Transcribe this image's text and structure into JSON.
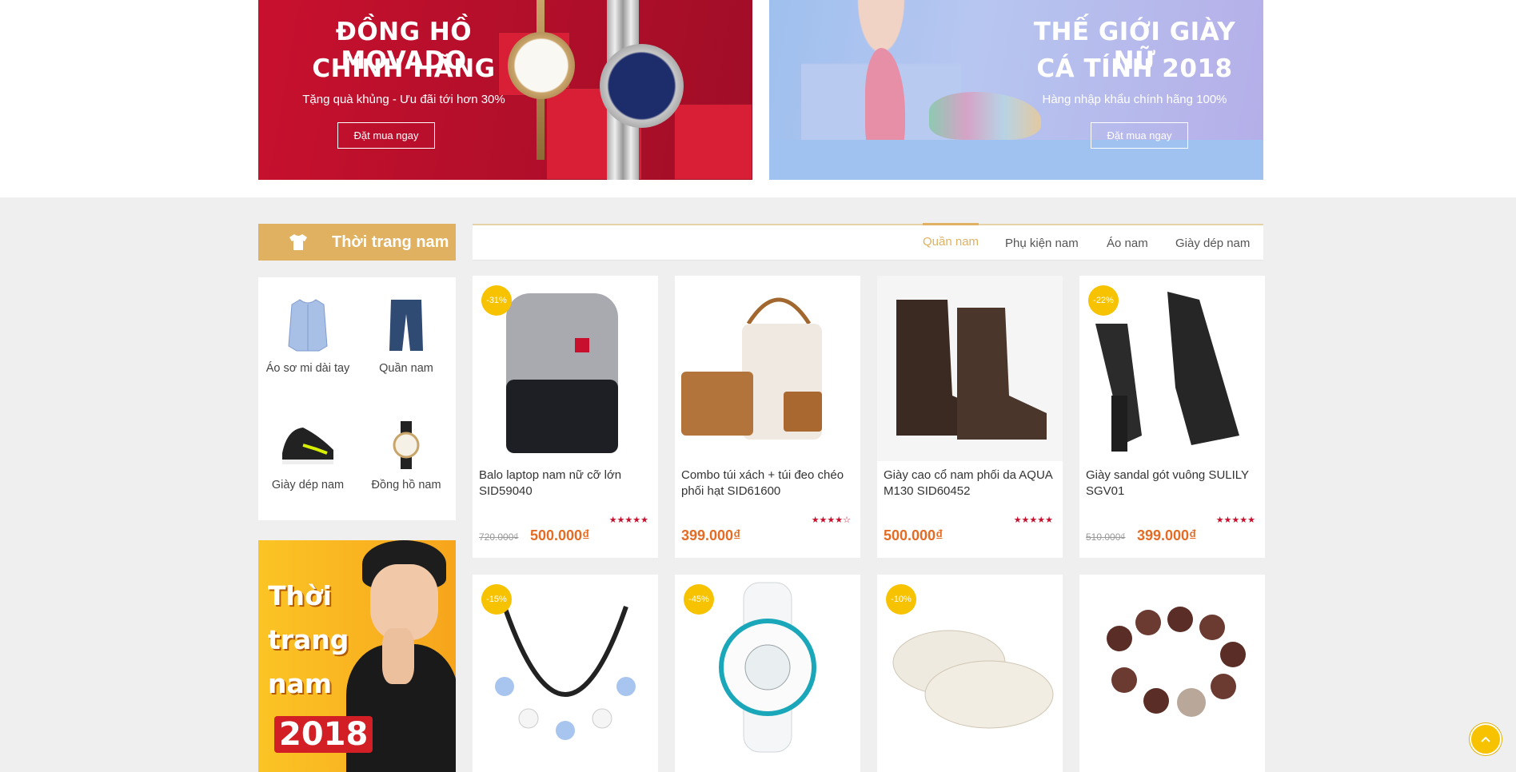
{
  "banners": [
    {
      "title_line1": "ĐỒNG HỒ MOVADO",
      "title_line2": "CHÍNH HÃNG",
      "subtitle": "Tặng quà khủng - Ưu đãi tới hơn 30%",
      "button": "Đặt mua ngay"
    },
    {
      "title_line1": "THẾ GIỚI GIÀY NỮ",
      "title_line2": "CÁ TÍNH 2018",
      "subtitle": "Hàng nhập khẩu chính hãng 100%",
      "button": "Đặt mua ngay"
    }
  ],
  "category": {
    "title": "Thời trang nam",
    "icon": "shirt-icon",
    "items": [
      {
        "label": "Áo sơ mi dài tay",
        "icon": "shirt-product-icon"
      },
      {
        "label": "Quần nam",
        "icon": "jeans-icon"
      },
      {
        "label": "Giày dép nam",
        "icon": "sneaker-icon"
      },
      {
        "label": "Đồng hồ nam",
        "icon": "watch-icon"
      }
    ],
    "promo": {
      "line1": "Thời",
      "line2": "trang",
      "line3": "nam",
      "year": "2018"
    }
  },
  "tabs": [
    "Quần nam",
    "Phụ kiện nam",
    "Áo nam",
    "Giày dép nam"
  ],
  "active_tab": "Quần nam",
  "products": [
    {
      "name": "Balo laptop nam nữ cỡ lớn SID59040",
      "badge": "-31%",
      "old_price": "720.000₫",
      "price": "500.000₫",
      "rating": 5,
      "image": "backpack"
    },
    {
      "name": "Combo túi xách + túi đeo chéo phối hạt SID61600",
      "badge": "",
      "old_price": "",
      "price": "399.000₫",
      "rating": 4,
      "image": "handbag-set"
    },
    {
      "name": "Giày cao cổ nam phối da AQUA M130 SID60452",
      "badge": "",
      "old_price": "",
      "price": "500.000₫",
      "rating": 5,
      "image": "boots"
    },
    {
      "name": "Giày sandal gót vuông SULILY SGV01",
      "badge": "-22%",
      "old_price": "510.000₫",
      "price": "399.000₫",
      "rating": 5,
      "image": "sandal"
    },
    {
      "name": "",
      "badge": "-15%",
      "image": "bracelet-beads"
    },
    {
      "name": "",
      "badge": "-45%",
      "image": "baby-g-watch"
    },
    {
      "name": "",
      "badge": "-10%",
      "image": "flat-shoes"
    },
    {
      "name": "",
      "badge": "",
      "image": "wood-bracelet"
    }
  ],
  "colors": {
    "accent": "#dfb161",
    "price": "#e46c25",
    "badge": "#f7c200",
    "star": "#c8102e"
  }
}
